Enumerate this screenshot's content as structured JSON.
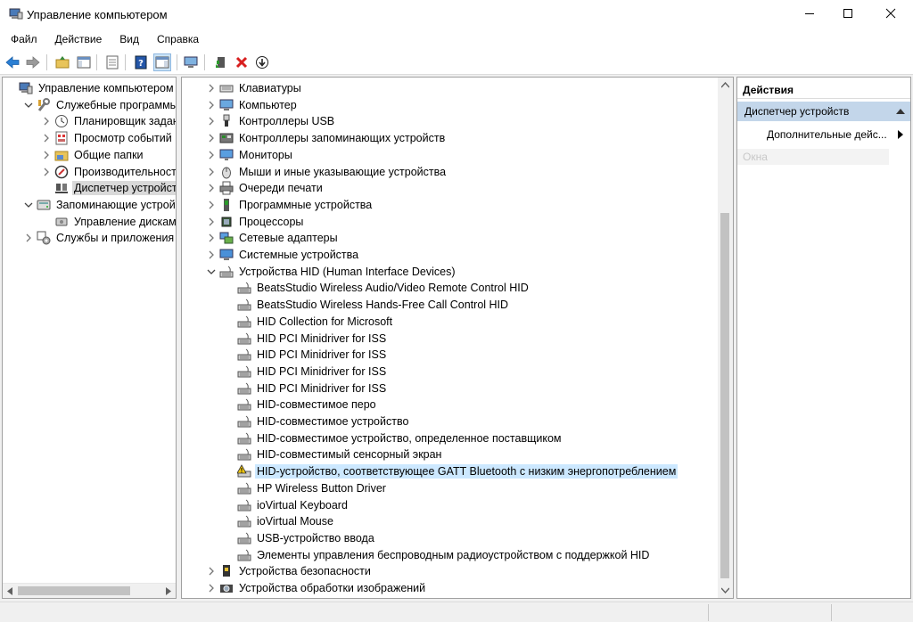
{
  "window": {
    "title": "Управление компьютером"
  },
  "menu": [
    "Файл",
    "Действие",
    "Вид",
    "Справка"
  ],
  "toolbar_icons": [
    "back-icon",
    "forward-icon",
    "up-folder-icon",
    "show-hide-tree-icon",
    "properties-icon",
    "help-icon",
    "show-hide-action-pane-icon",
    "scan-hardware-icon",
    "update-driver-icon",
    "uninstall-icon",
    "disable-device-icon"
  ],
  "left_tree": [
    {
      "label": "Управление компьютером (лс",
      "level": 0,
      "expander": "none",
      "icon": "computer-management-icon"
    },
    {
      "label": "Служебные программы",
      "level": 1,
      "expander": "open",
      "icon": "tools-icon"
    },
    {
      "label": "Планировщик заданий",
      "level": 2,
      "expander": "closed",
      "icon": "clock-icon"
    },
    {
      "label": "Просмотр событий",
      "level": 2,
      "expander": "closed",
      "icon": "event-viewer-icon"
    },
    {
      "label": "Общие папки",
      "level": 2,
      "expander": "closed",
      "icon": "shared-folder-icon"
    },
    {
      "label": "Производительность",
      "level": 2,
      "expander": "closed",
      "icon": "performance-icon"
    },
    {
      "label": "Диспетчер устройств",
      "level": 2,
      "expander": "none",
      "icon": "device-manager-icon",
      "selected": true
    },
    {
      "label": "Запоминающие устройств",
      "level": 1,
      "expander": "open",
      "icon": "storage-icon"
    },
    {
      "label": "Управление дисками",
      "level": 2,
      "expander": "none",
      "icon": "disk-management-icon"
    },
    {
      "label": "Службы и приложения",
      "level": 1,
      "expander": "closed",
      "icon": "services-icon"
    }
  ],
  "device_tree": [
    {
      "label": "Клавиатуры",
      "level": 0,
      "expander": "closed",
      "icon": "keyboard-icon"
    },
    {
      "label": "Компьютер",
      "level": 0,
      "expander": "closed",
      "icon": "computer-icon"
    },
    {
      "label": "Контроллеры USB",
      "level": 0,
      "expander": "closed",
      "icon": "usb-icon"
    },
    {
      "label": "Контроллеры запоминающих устройств",
      "level": 0,
      "expander": "closed",
      "icon": "storage-controller-icon"
    },
    {
      "label": "Мониторы",
      "level": 0,
      "expander": "closed",
      "icon": "monitor-icon"
    },
    {
      "label": "Мыши и иные указывающие устройства",
      "level": 0,
      "expander": "closed",
      "icon": "mouse-icon"
    },
    {
      "label": "Очереди печати",
      "level": 0,
      "expander": "closed",
      "icon": "printer-icon"
    },
    {
      "label": "Программные устройства",
      "level": 0,
      "expander": "closed",
      "icon": "software-device-icon"
    },
    {
      "label": "Процессоры",
      "level": 0,
      "expander": "closed",
      "icon": "processor-icon"
    },
    {
      "label": "Сетевые адаптеры",
      "level": 0,
      "expander": "closed",
      "icon": "network-adapter-icon"
    },
    {
      "label": "Системные устройства",
      "level": 0,
      "expander": "closed",
      "icon": "system-device-icon"
    },
    {
      "label": "Устройства HID (Human Interface Devices)",
      "level": 0,
      "expander": "open",
      "icon": "hid-icon"
    },
    {
      "label": "BeatsStudio Wireless Audio/Video Remote Control HID",
      "level": 1,
      "expander": "none",
      "icon": "hid-icon"
    },
    {
      "label": "BeatsStudio Wireless Hands-Free Call Control HID",
      "level": 1,
      "expander": "none",
      "icon": "hid-icon"
    },
    {
      "label": "HID Collection for Microsoft",
      "level": 1,
      "expander": "none",
      "icon": "hid-icon"
    },
    {
      "label": "HID PCI Minidriver for ISS",
      "level": 1,
      "expander": "none",
      "icon": "hid-icon"
    },
    {
      "label": "HID PCI Minidriver for ISS",
      "level": 1,
      "expander": "none",
      "icon": "hid-icon"
    },
    {
      "label": "HID PCI Minidriver for ISS",
      "level": 1,
      "expander": "none",
      "icon": "hid-icon"
    },
    {
      "label": "HID PCI Minidriver for ISS",
      "level": 1,
      "expander": "none",
      "icon": "hid-icon"
    },
    {
      "label": "HID-совместимое перо",
      "level": 1,
      "expander": "none",
      "icon": "hid-icon"
    },
    {
      "label": "HID-совместимое устройство",
      "level": 1,
      "expander": "none",
      "icon": "hid-icon"
    },
    {
      "label": "HID-совместимое устройство, определенное поставщиком",
      "level": 1,
      "expander": "none",
      "icon": "hid-icon"
    },
    {
      "label": "HID-совместимый сенсорный экран",
      "level": 1,
      "expander": "none",
      "icon": "hid-icon"
    },
    {
      "label": "HID-устройство, соответствующее GATT Bluetooth с низким энергопотреблением",
      "level": 1,
      "expander": "none",
      "icon": "hid-warning-icon",
      "selected": true
    },
    {
      "label": "HP Wireless Button Driver",
      "level": 1,
      "expander": "none",
      "icon": "hid-icon"
    },
    {
      "label": "ioVirtual Keyboard",
      "level": 1,
      "expander": "none",
      "icon": "hid-icon"
    },
    {
      "label": "ioVirtual Mouse",
      "level": 1,
      "expander": "none",
      "icon": "hid-icon"
    },
    {
      "label": "USB-устройство ввода",
      "level": 1,
      "expander": "none",
      "icon": "hid-icon"
    },
    {
      "label": "Элементы управления беспроводным радиоустройством с поддержкой HID",
      "level": 1,
      "expander": "none",
      "icon": "hid-icon"
    },
    {
      "label": "Устройства безопасности",
      "level": 0,
      "expander": "closed",
      "icon": "security-device-icon"
    },
    {
      "label": "Устройства обработки изображений",
      "level": 0,
      "expander": "closed",
      "icon": "imaging-device-icon"
    }
  ],
  "actions": {
    "header": "Действия",
    "group": "Диспетчер устройств",
    "more": "Дополнительные дейс...",
    "faded": "Окна"
  },
  "colors": {
    "selection_gray": "#d9d9d9",
    "selection_blue": "#cce8ff",
    "action_group_bg": "#c3d6ea",
    "close_red": "#e81123"
  }
}
